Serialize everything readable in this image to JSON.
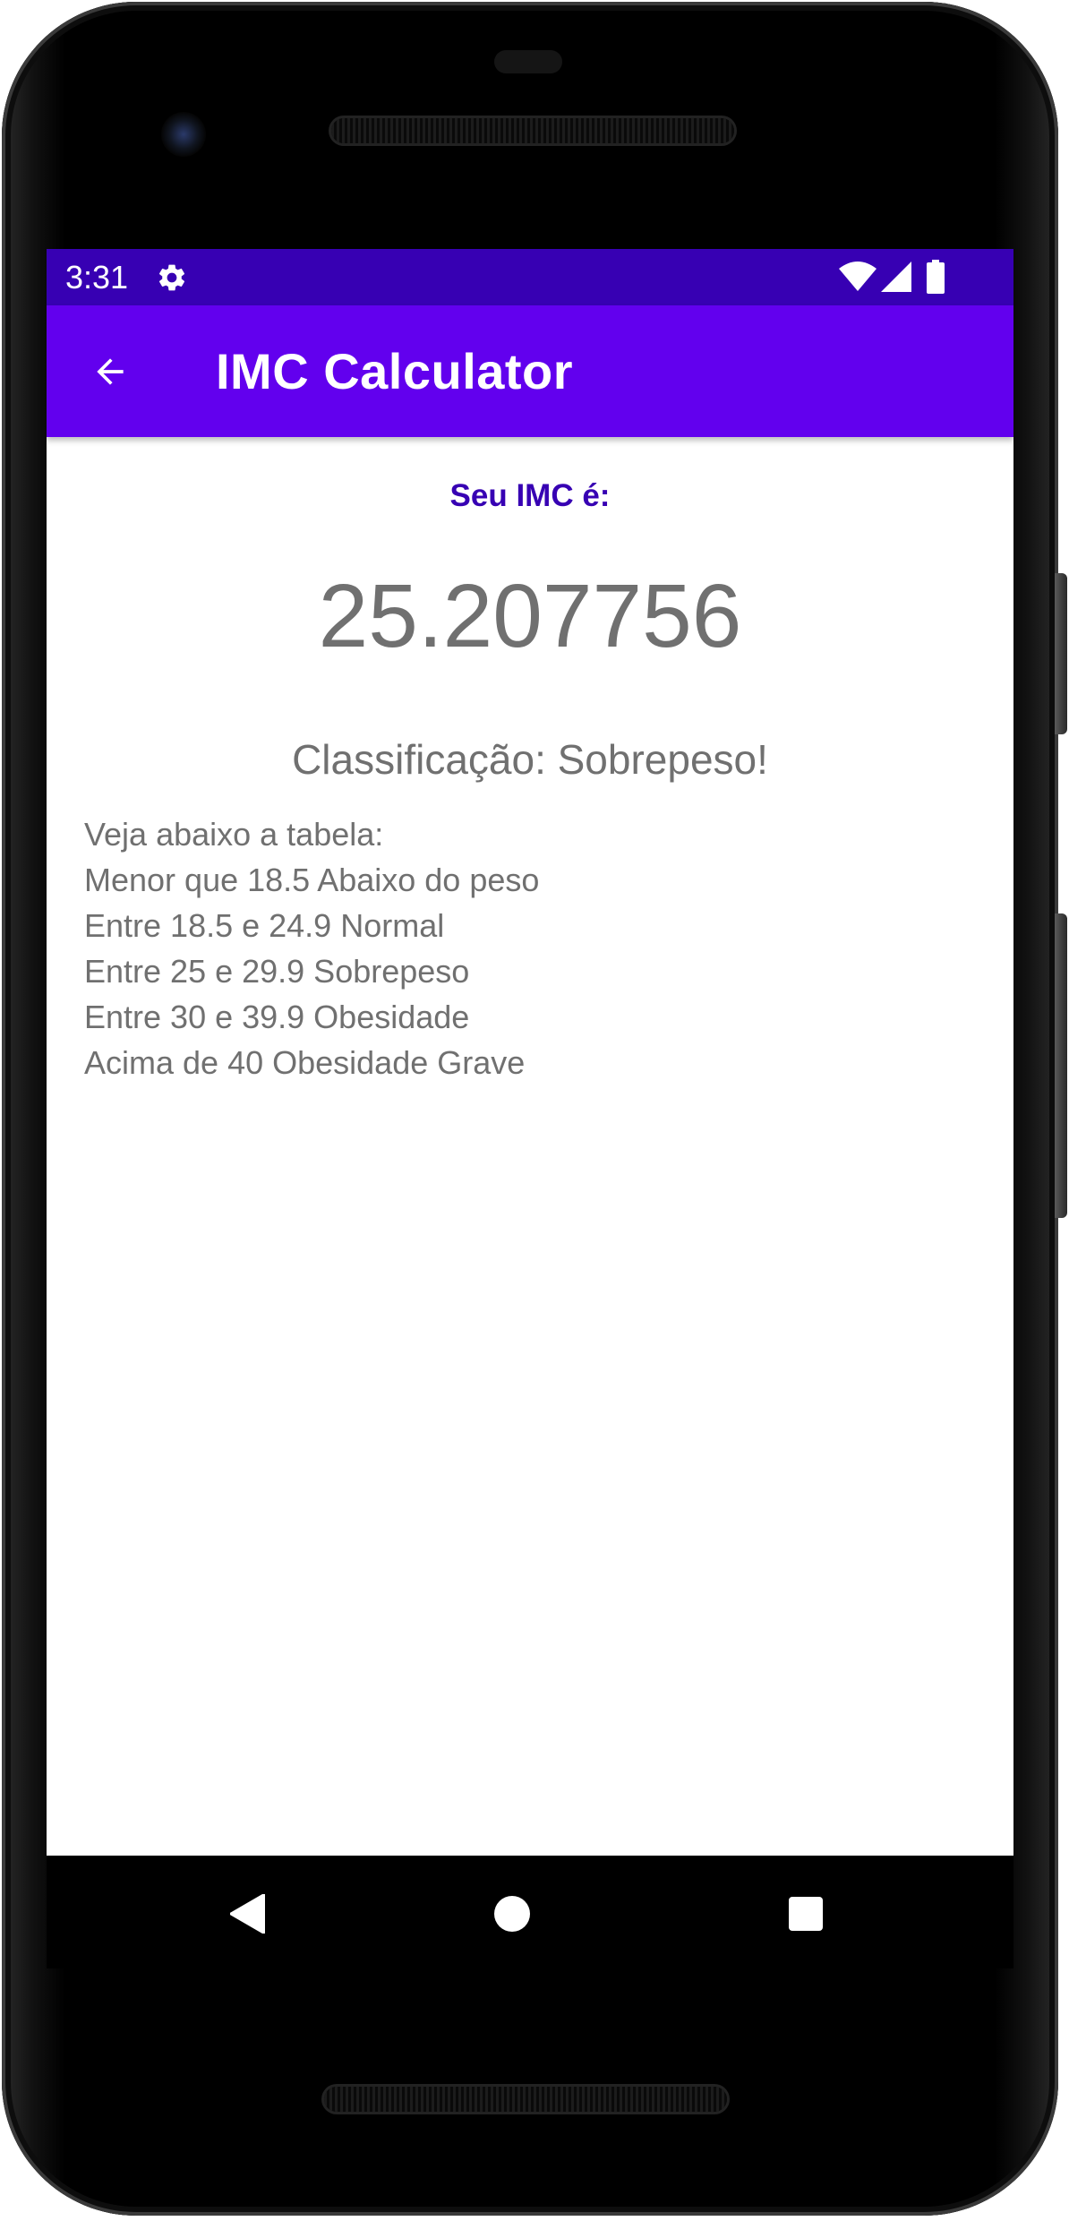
{
  "status_bar": {
    "time": "3:31",
    "icons": [
      "gear-icon",
      "wifi-icon",
      "signal-icon",
      "battery-icon"
    ],
    "background": "#3700b3"
  },
  "app_bar": {
    "title": "IMC Calculator",
    "back_icon": "arrow-left-icon",
    "background": "#6200ee"
  },
  "result": {
    "label": "Seu IMC é:",
    "value": "25.207756",
    "classification": "Classificação: Sobrepeso!"
  },
  "table": {
    "lines": [
      "Veja abaixo a tabela:",
      "Menor que 18.5 Abaixo do peso",
      "Entre 18.5 e 24.9 Normal",
      "Entre 25 e 29.9 Sobrepeso",
      "Entre 30 e 39.9 Obesidade",
      "Acima de 40 Obesidade Grave"
    ]
  },
  "nav_bar": {
    "icons": [
      "nav-back-icon",
      "nav-home-icon",
      "nav-recents-icon"
    ]
  },
  "colors": {
    "accent": "#3700b3",
    "text_gray": "#707070"
  }
}
